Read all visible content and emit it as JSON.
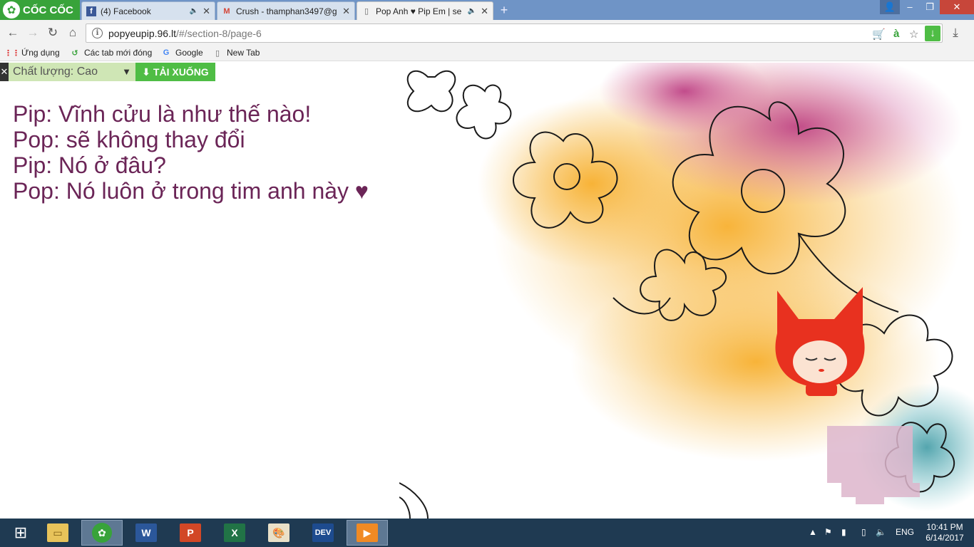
{
  "browser": {
    "brand": "CỐC CỐC",
    "tabs": [
      {
        "title": "(4) Facebook",
        "favicon": "facebook-icon",
        "audio": true
      },
      {
        "title": "Crush - thamphan3497@g",
        "favicon": "gmail-icon",
        "audio": false
      },
      {
        "title": "Pop Anh ♥ Pip Em | se",
        "favicon": "page-icon",
        "audio": true,
        "active": true
      }
    ],
    "new_tab_symbol": "+",
    "url": {
      "host": "popyeupip.96.lt",
      "path": "/#/section-8/page-6"
    }
  },
  "bookmarks": [
    {
      "label": "Ứng dụng",
      "icon": "apps-grid-icon"
    },
    {
      "label": "Các tab mới đóng",
      "icon": "recent-tabs-icon"
    },
    {
      "label": "Google",
      "icon": "google-icon"
    },
    {
      "label": "New Tab",
      "icon": "page-icon"
    }
  ],
  "player_bar": {
    "close": "✕",
    "quality_label": "Chất lượng: Cao",
    "download_label": "TẢI XUỐNG"
  },
  "content": {
    "lines": [
      "Pip: Vĩnh cửu là như thế nào!",
      "Pop: sẽ không thay đổi",
      "Pip: Nó ở đâu?",
      "Pop: Nó luôn ở trong tim anh này"
    ],
    "heart": "♥"
  },
  "taskbar": {
    "apps": [
      "start",
      "file-explorer",
      "coccoc-browser",
      "word",
      "powerpoint",
      "excel",
      "paint",
      "dev-cpp",
      "media-player"
    ],
    "language": "ENG",
    "time": "10:41 PM",
    "date": "6/14/2017"
  },
  "colors": {
    "text_accent": "#6b2557",
    "download_green": "#4fbd45",
    "brand_green": "#38a33a",
    "taskbar": "#1f3a52"
  }
}
